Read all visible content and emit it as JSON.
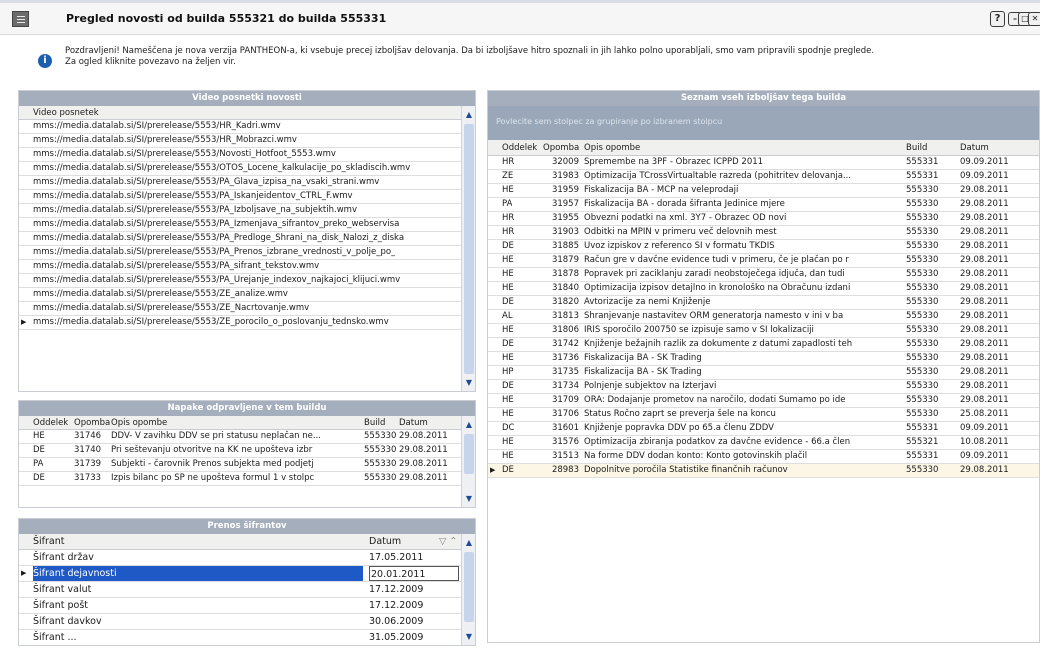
{
  "window": {
    "title": "Pregled novosti od builda 555321 do builda 555331",
    "help_label": "?",
    "minimize_label": "–",
    "maximize_label": "□",
    "close_label": "✕"
  },
  "info": {
    "icon": "info-icon",
    "text_line1": "Pozdravljeni! Nameščena je nova verzija PANTHEON-a, ki vsebuje precej izboljšav delovanja. Da bi izboljšave hitro spoznali in jih lahko polno uporabljali, smo vam pripravili spodnje preglede.",
    "text_line2": "Za ogled kliknite povezavo na željen vir."
  },
  "videos": {
    "panel_title": "Video posnetki novosti",
    "column_header": "Video posnetek",
    "rows": [
      "mms://media.datalab.si/SI/prerelease/5553/HR_Kadri.wmv",
      "mms://media.datalab.si/SI/prerelease/5553/HR_Mobrazci.wmv",
      "mms://media.datalab.si/SI/prerelease/5553/Novosti_Hotfoot_5553.wmv",
      "mms://media.datalab.si/SI/prerelease/5553/OTOS_Locene_kalkulacije_po_skladiscih.wmv",
      "mms://media.datalab.si/SI/prerelease/5553/PA_Glava_izpisa_na_vsaki_strani.wmv",
      "mms://media.datalab.si/SI/prerelease/5553/PA_Iskanjeidentov_CTRL_F.wmv",
      "mms://media.datalab.si/SI/prerelease/5553/PA_Izboljsave_na_subjektih.wmv",
      "mms://media.datalab.si/SI/prerelease/5553/PA_Izmenjava_sifrantov_preko_webservisa",
      "mms://media.datalab.si/SI/prerelease/5553/PA_Predloge_Shrani_na_disk_Nalozi_z_diska",
      "mms://media.datalab.si/SI/prerelease/5553/PA_Prenos_izbrane_vrednosti_v_polje_po_",
      "mms://media.datalab.si/SI/prerelease/5553/PA_sifrant_tekstov.wmv",
      "mms://media.datalab.si/SI/prerelease/5553/PA_Urejanje_indexov_najkajoci_klijuci.wmv",
      "mms://media.datalab.si/SI/prerelease/5553/ZE_analize.wmv",
      "mms://media.datalab.si/SI/prerelease/5553/ZE_Nacrtovanje.wmv",
      "mms://media.datalab.si/SI/prerelease/5553/ZE_porocilo_o_poslovanju_tednsko.wmv"
    ]
  },
  "errors": {
    "panel_title": "Napake odpravljene v tem buildu",
    "headers": {
      "oddelek": "Oddelek",
      "opomba": "Opomba",
      "opis": "Opis opombe",
      "build": "Build",
      "datum": "Datum"
    },
    "rows": [
      {
        "oddelek": "HE",
        "opomba": "31746",
        "opis": "DDV- V zavihku DDV se pri statusu neplačan ne...",
        "build": "555330",
        "datum": "29.08.2011"
      },
      {
        "oddelek": "DE",
        "opomba": "31740",
        "opis": "Pri sešteva­nju otvoritve na KK ne upošteva izbr",
        "build": "555330",
        "datum": "29.08.2011"
      },
      {
        "oddelek": "PA",
        "opomba": "31739",
        "opis": "Subjekti - čarovnik Prenos subjekta med podjetj",
        "build": "555330",
        "datum": "29.08.2011"
      },
      {
        "oddelek": "DE",
        "opomba": "31733",
        "opis": "Izpis bilanc po SP ne upošteva formul 1 v stolpc",
        "build": "555330",
        "datum": "29.08.2011"
      }
    ]
  },
  "sifranti": {
    "panel_title": "Prenos šifrantov",
    "headers": {
      "sifrant": "Šifrant",
      "datum": "Datum"
    },
    "rows": [
      {
        "sifrant": "Šifrant držav",
        "datum": "17.05.2011"
      },
      {
        "sifrant": "Šifrant dejavnosti",
        "datum": "20.01.2011"
      },
      {
        "sifrant": "Šifrant valut",
        "datum": "17.12.2009"
      },
      {
        "sifrant": "Šifrant pošt",
        "datum": "17.12.2009"
      },
      {
        "sifrant": "Šifrant davkov",
        "datum": "30.06.2009"
      },
      {
        "sifrant": "Šifrant ...",
        "datum": "31.05.2009"
      }
    ]
  },
  "improvements": {
    "panel_title": "Seznam vseh izboljšav tega builda",
    "group_hint": "Povlecite sem stolpec za grupiranje po izbranem stolpcu",
    "headers": {
      "oddelek": "Oddelek",
      "opomba": "Opomba",
      "opis": "Opis opombe",
      "build": "Build",
      "datum": "Datum"
    },
    "rows": [
      {
        "oddelek": "HR",
        "opomba": "32009",
        "opis": "Spremembe na 3PF - Obrazec ICPPD 2011",
        "build": "555331",
        "datum": "09.09.2011"
      },
      {
        "oddelek": "ZE",
        "opomba": "31983",
        "opis": "Optimizacija TCrossVirtualtable razreda (pohitritev delovanja...",
        "build": "555331",
        "datum": "09.09.2011"
      },
      {
        "oddelek": "HE",
        "opomba": "31959",
        "opis": "Fiskalizacija BA - MCP na veleprodaji",
        "build": "555330",
        "datum": "29.08.2011"
      },
      {
        "oddelek": "PA",
        "opomba": "31957",
        "opis": "Fiskalizacija BA - dorada šifranta Jedinice mjere",
        "build": "555330",
        "datum": "29.08.2011"
      },
      {
        "oddelek": "HR",
        "opomba": "31955",
        "opis": "Obvezni podatki na xml. 3Y7 - Obrazec OD novi",
        "build": "555330",
        "datum": "29.08.2011"
      },
      {
        "oddelek": "HR",
        "opomba": "31903",
        "opis": "Odbitki na MPIN v primeru več delovnih mest",
        "build": "555330",
        "datum": "29.08.2011"
      },
      {
        "oddelek": "DE",
        "opomba": "31885",
        "opis": "Uvoz izpiskov z referenco SI v formatu TKDIS",
        "build": "555330",
        "datum": "29.08.2011"
      },
      {
        "oddelek": "HE",
        "opomba": "31879",
        "opis": "Račun gre v davčne evidence tudi v primeru, če je plačan po r",
        "build": "555330",
        "datum": "29.08.2011"
      },
      {
        "oddelek": "HE",
        "opomba": "31878",
        "opis": "Popravek pri zaciklanju zaradi neobstoječega idjuča, dan tudi",
        "build": "555330",
        "datum": "29.08.2011"
      },
      {
        "oddelek": "HE",
        "opomba": "31840",
        "opis": "Optimizacija izpisov detajlno in kronološko na Obračunu izdani",
        "build": "555330",
        "datum": "29.08.2011"
      },
      {
        "oddelek": "DE",
        "opomba": "31820",
        "opis": "Avtorizacije za nemi Knjiženje",
        "build": "555330",
        "datum": "29.08.2011"
      },
      {
        "oddelek": "AL",
        "opomba": "31813",
        "opis": "Shranjevanje nastavitev ORM generatorja namesto v ini v ba",
        "build": "555330",
        "datum": "29.08.2011"
      },
      {
        "oddelek": "HE",
        "opomba": "31806",
        "opis": "IRIS sporočilo 200750 se izpisuje samo v SI lokalizaciji",
        "build": "555330",
        "datum": "29.08.2011"
      },
      {
        "oddelek": "DE",
        "opomba": "31742",
        "opis": "Knjiženje bežajnih razlik za dokumente z datumi zapadlosti teh",
        "build": "555330",
        "datum": "29.08.2011"
      },
      {
        "oddelek": "HE",
        "opomba": "31736",
        "opis": "Fiskalizacija BA - SK Trading",
        "build": "555330",
        "datum": "29.08.2011"
      },
      {
        "oddelek": "HP",
        "opomba": "31735",
        "opis": "Fiskalizacija BA - SK Trading",
        "build": "555330",
        "datum": "29.08.2011"
      },
      {
        "oddelek": "DE",
        "opomba": "31734",
        "opis": "Polnjenje subjektov na Izterjavi",
        "build": "555330",
        "datum": "29.08.2011"
      },
      {
        "oddelek": "HE",
        "opomba": "31709",
        "opis": "ORA: Dodajanje prometov na naročilo, dodati Sumamo po ide",
        "build": "555330",
        "datum": "29.08.2011"
      },
      {
        "oddelek": "HE",
        "opomba": "31706",
        "opis": "Status Ročno zaprt se preverja šele na koncu",
        "build": "555330",
        "datum": "25.08.2011"
      },
      {
        "oddelek": "DC",
        "opomba": "31601",
        "opis": "Knjiženje popravka DDV po 65.a členu ZDDV",
        "build": "555331",
        "datum": "09.09.2011"
      },
      {
        "oddelek": "HE",
        "opomba": "31576",
        "opis": "Optimizacija zbiranja podatkov za davčne evidence - 66.a člen",
        "build": "555321",
        "datum": "10.08.2011"
      },
      {
        "oddelek": "HE",
        "opomba": "31513",
        "opis": "Na forme DDV dodan konto: Konto gotovinskih plačil",
        "build": "555331",
        "datum": "09.09.2011"
      },
      {
        "oddelek": "DE",
        "opomba": "28983",
        "opis": "Dopolnitve poročila Statistike finančnih računov",
        "build": "555330",
        "datum": "29.08.2011"
      }
    ]
  }
}
